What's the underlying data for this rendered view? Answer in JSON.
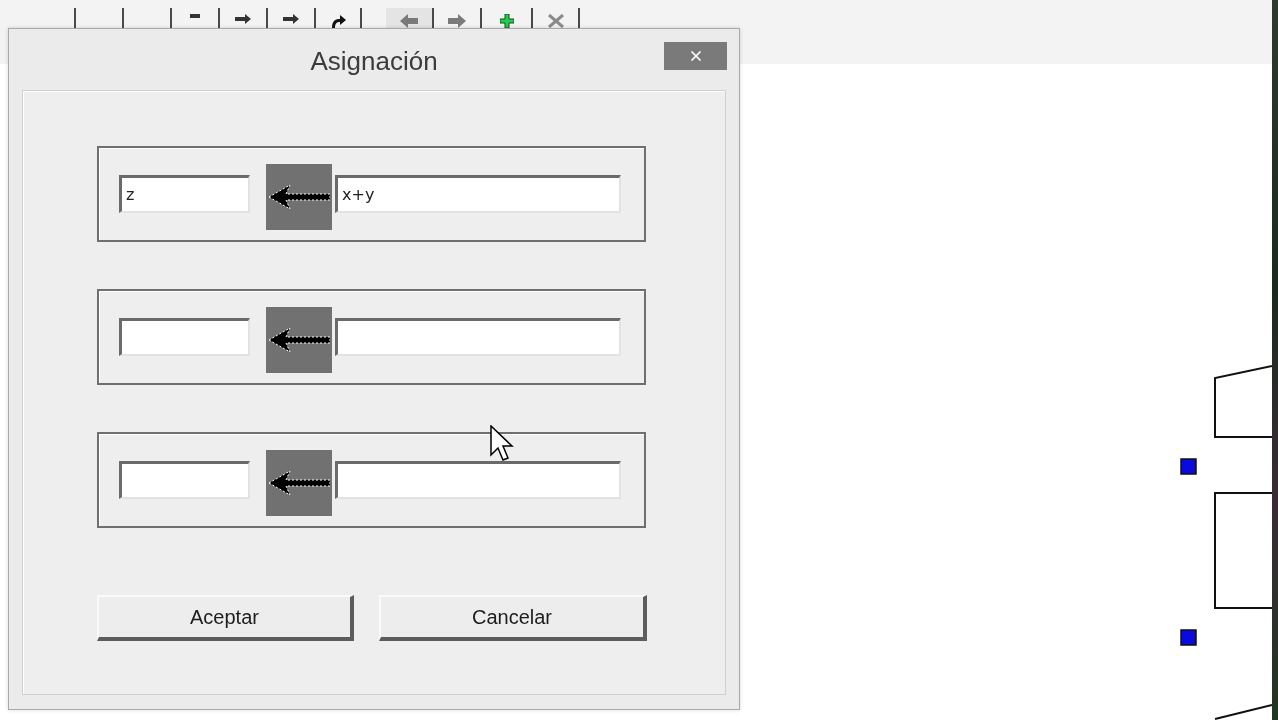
{
  "dialog": {
    "title": "Asignación",
    "assignments": [
      {
        "kind": "assignment",
        "variable": "z",
        "expression": "x+y"
      },
      {
        "kind": "assignment"
      },
      {
        "kind": "assignment"
      }
    ],
    "buttons": [
      {
        "label": "Aceptar"
      },
      {
        "label": "Cancelar"
      }
    ]
  }
}
